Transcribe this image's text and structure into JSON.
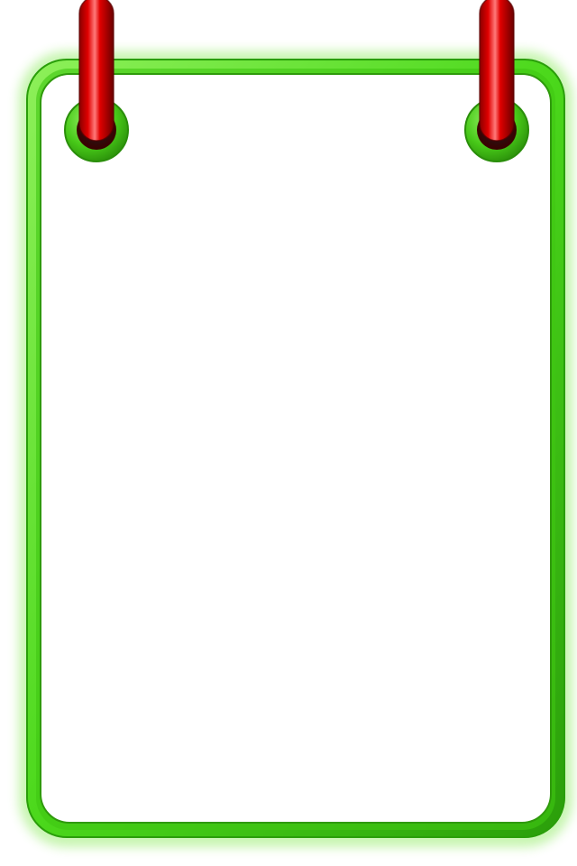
{
  "sign": {
    "frame_color": "#4bd81b",
    "frame_highlight": "#8ef05a",
    "frame_shadow": "#2a9e0a",
    "panel_color": "#ffffff",
    "strap_color": "#e00000",
    "strap_highlight": "#ff6a6a",
    "strap_shadow": "#7a0000",
    "grommet_color": "#47c818",
    "hanger_count": 2,
    "content_text": ""
  }
}
